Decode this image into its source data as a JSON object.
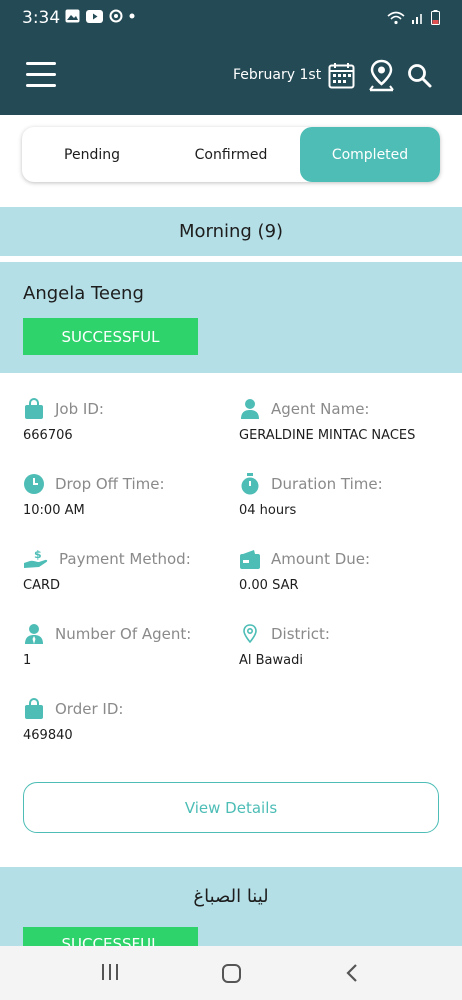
{
  "status_bar": {
    "time": "3:34",
    "icons": [
      "gallery-icon",
      "youtube-icon",
      "sync-icon",
      "dot-icon",
      "wifi-icon",
      "signal-icon",
      "battery-icon"
    ]
  },
  "app_bar": {
    "date": "February 1st",
    "icons": [
      "menu-icon",
      "calendar-icon",
      "location-icon",
      "search-icon"
    ]
  },
  "tabs": {
    "pending": "Pending",
    "confirmed": "Confirmed",
    "completed": "Completed",
    "active": "completed"
  },
  "section": {
    "title": "Morning (9)"
  },
  "order": {
    "customer": "Angela Teeng",
    "status": "SUCCESSFUL",
    "fields": {
      "job_id": {
        "label": "Job ID:",
        "value": "666706"
      },
      "agent_name": {
        "label": "Agent Name:",
        "value": "GERALDINE MINTAC NACES"
      },
      "drop_off_time": {
        "label": "Drop Off Time:",
        "value": "10:00 AM"
      },
      "duration_time": {
        "label": "Duration Time:",
        "value": "04 hours"
      },
      "payment_method": {
        "label": "Payment Method:",
        "value": "CARD"
      },
      "amount_due": {
        "label": "Amount Due:",
        "value": "0.00 SAR"
      },
      "number_of_agent": {
        "label": "Number Of Agent:",
        "value": "1"
      },
      "district": {
        "label": "District:",
        "value": "Al Bawadi"
      },
      "order_id": {
        "label": "Order ID:",
        "value": "469840"
      }
    },
    "view_details": "View Details"
  },
  "next_order": {
    "customer": "لينا الصباغ",
    "status": "SUCCESSFUL"
  },
  "colors": {
    "app_bar": "#234a55",
    "accent": "#4dbdb6",
    "section_bg": "#b5dfe6",
    "success": "#2ed36b"
  }
}
